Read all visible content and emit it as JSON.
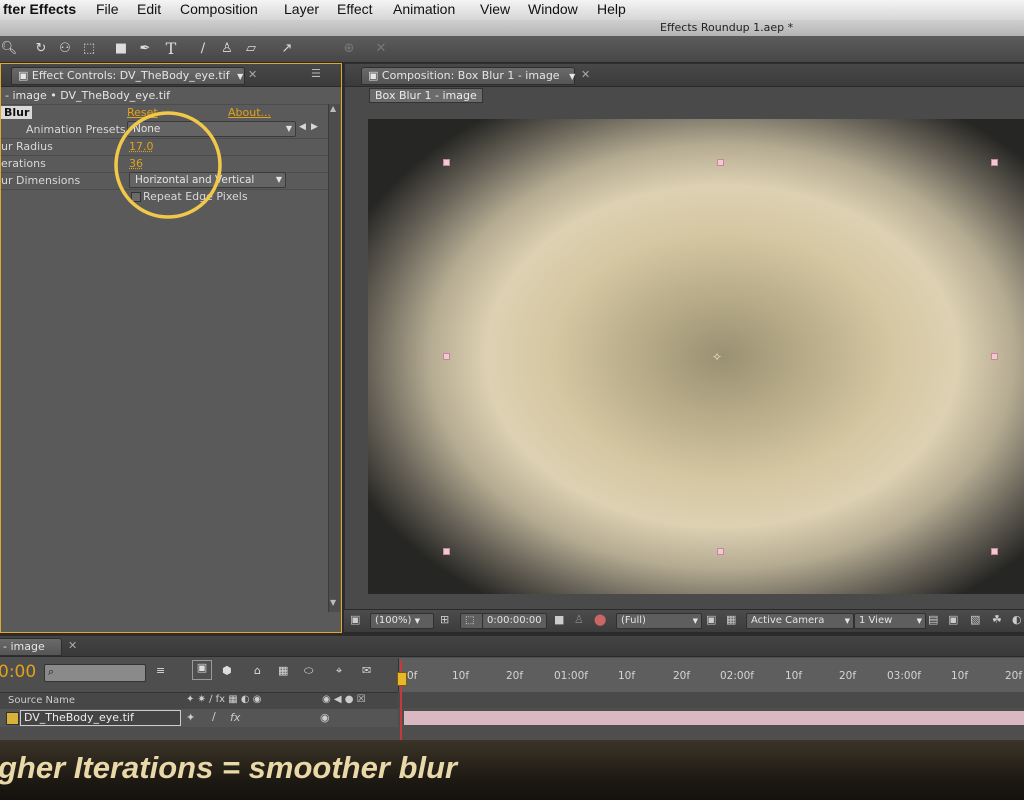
{
  "menu": {
    "app": "fter Effects",
    "items": [
      "File",
      "Edit",
      "Composition",
      "Layer",
      "Effect",
      "Animation",
      "View",
      "Window",
      "Help"
    ]
  },
  "window_title": "Effects Roundup 1.aep *",
  "toolbar": {
    "icons": [
      "zoom-icon",
      "rotate-icon",
      "camera-orbit-icon",
      "pan-behind-icon",
      "rectangle-mask-icon",
      "pen-icon",
      "type-icon",
      "brush-icon",
      "clone-stamp-icon",
      "eraser-icon",
      "puppet-pin-icon"
    ]
  },
  "effect_controls": {
    "tab_label": "Effect Controls: DV_TheBody_eye.tif",
    "breadcrumb": "- image • DV_TheBody_eye.tif",
    "effect_name": "Blur",
    "reset_label": "Reset",
    "about_label": "About...",
    "presets_label": "Animation Presets:",
    "presets_value": "None",
    "params": [
      {
        "label": "ur Radius",
        "value": "17.0"
      },
      {
        "label": "erations",
        "value": "36"
      },
      {
        "label": "ur Dimensions",
        "value": "Horizontal and Vertical"
      }
    ],
    "checkbox_label": "Repeat Edge Pixels"
  },
  "composition": {
    "tab_label": "Composition: Box Blur 1 - image",
    "crumb": "Box Blur 1 - image"
  },
  "viewer_bar": {
    "zoom": "(100%)",
    "timecode": "0:00:00:00",
    "resolution": "(Full)",
    "camera": "Active Camera",
    "views": "1 View"
  },
  "timeline": {
    "tab_label": "- image",
    "current_time": "0:00",
    "column_header": "Source Name",
    "layer_name": "DV_TheBody_eye.tif",
    "ruler": [
      "0f",
      "10f",
      "20f",
      "01:00f",
      "10f",
      "20f",
      "02:00f",
      "10f",
      "20f",
      "03:00f",
      "10f",
      "20f"
    ]
  },
  "caption": "gher Iterations = smoother blur",
  "colors": {
    "accent": "#e0a21a",
    "highlight_circle": "#f2c84a",
    "layer_bar": "#d9b8c1"
  }
}
